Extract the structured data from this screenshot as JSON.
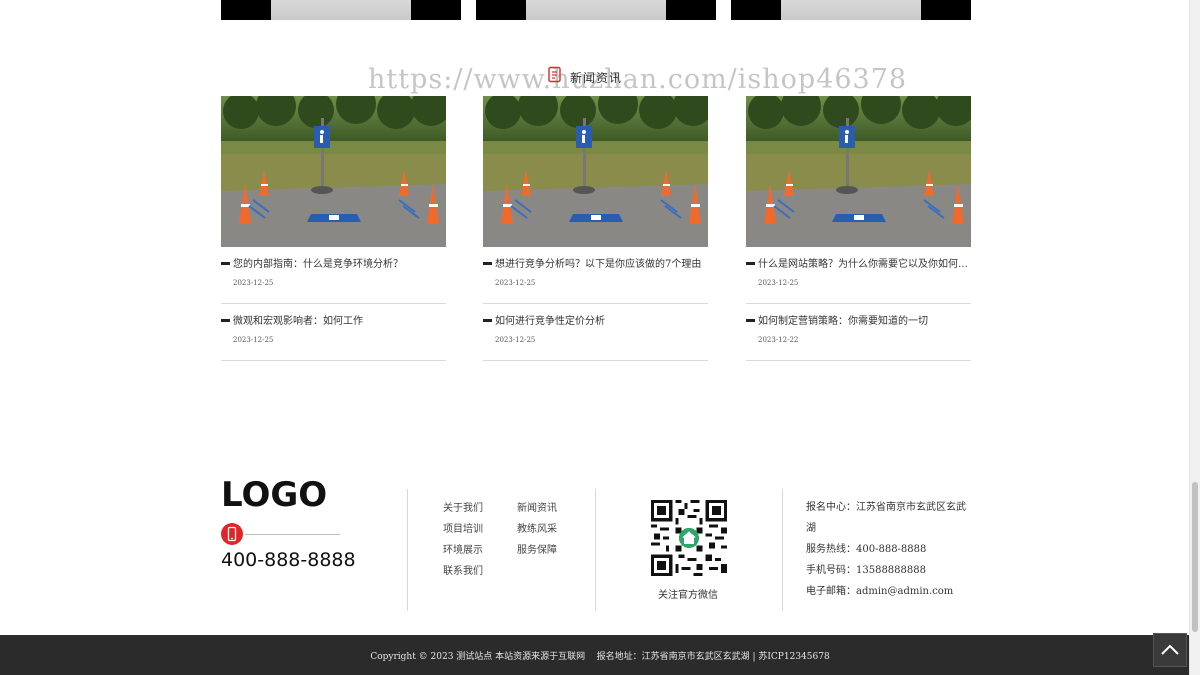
{
  "news_section": {
    "heading": "新闻资讯",
    "watermark": "https://www.huzhan.com/ishop46378",
    "columns": [
      {
        "items": [
          {
            "title": "您的内部指南：什么是竞争环境分析？",
            "date": "2023-12-25"
          },
          {
            "title": "微观和宏观影响者：如何工作",
            "date": "2023-12-25"
          }
        ]
      },
      {
        "items": [
          {
            "title": "想进行竞争分析吗？以下是你应该做的7个理由",
            "date": "2023-12-25"
          },
          {
            "title": "如何进行竞争性定价分析",
            "date": "2023-12-25"
          }
        ]
      },
      {
        "items": [
          {
            "title": "什么是网站策略？为什么你需要它以及你如何…",
            "date": "2023-12-25"
          },
          {
            "title": "如何制定营销策略：你需要知道的一切",
            "date": "2023-12-22"
          }
        ]
      }
    ]
  },
  "footer": {
    "logo": "LOGO",
    "hotline": "400-888-8888",
    "links_col1": [
      "关于我们",
      "项目培训",
      "环境展示",
      "联系我们"
    ],
    "links_col2": [
      "新闻资讯",
      "教练风采",
      "服务保障"
    ],
    "qr_label": "关注官方微信",
    "contact": {
      "address": "报名中心：江苏省南京市玄武区玄武湖",
      "service": "服务热线：400-888-8888",
      "mobile": "手机号码：13588888888",
      "email": "电子邮箱：admin@admin.com"
    },
    "copyright": "Copyright © 2023 测试站点 本站资源来源于互联网    报名地址：江苏省南京市玄武区玄武湖 | 苏ICP12345678"
  },
  "colors": {
    "accent": "#e0252b",
    "footer_bar": "#2b2b2b"
  },
  "icons": {
    "section": "document-icon",
    "phone": "mobile-phone-icon",
    "back_top": "chevron-up-icon"
  }
}
